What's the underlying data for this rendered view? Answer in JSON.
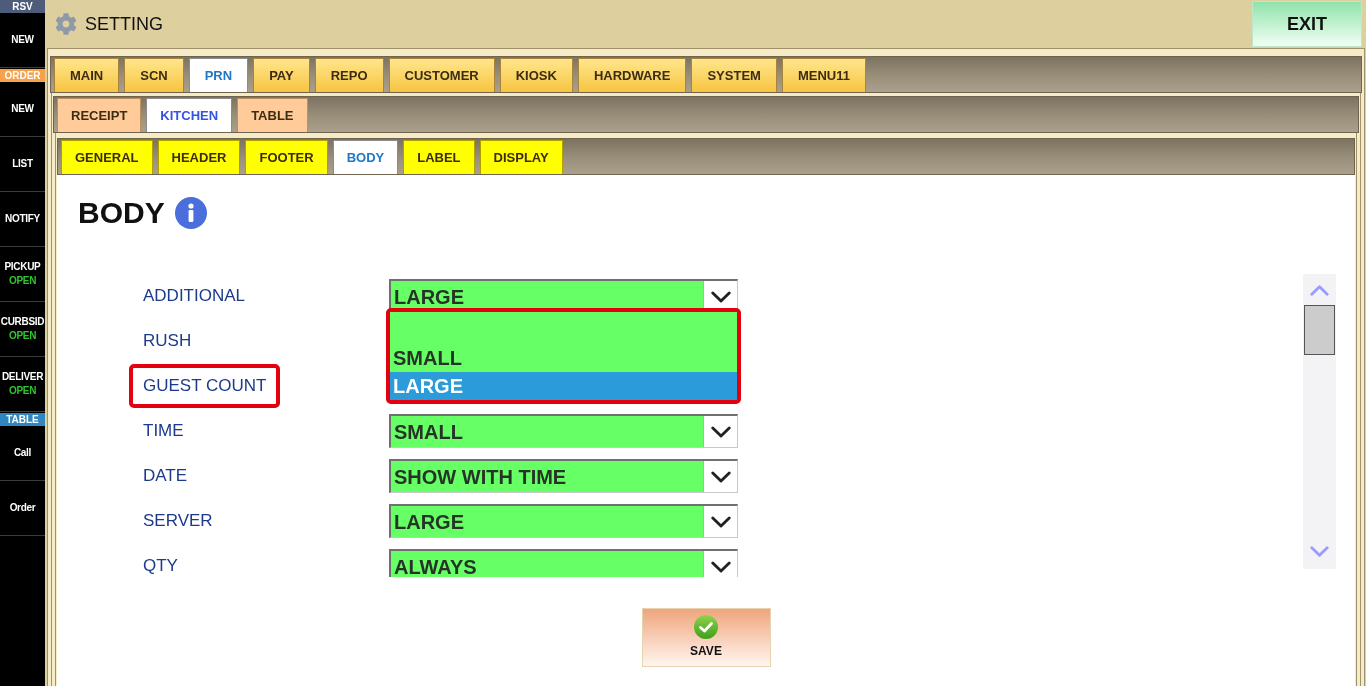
{
  "sidebar": {
    "sections": [
      {
        "title": "RSV",
        "color": "#4e5c7c",
        "items": [
          {
            "label": "NEW"
          }
        ]
      },
      {
        "title": "ORDER",
        "color": "#f7a24a",
        "items": [
          {
            "label": "NEW"
          },
          {
            "label": "LIST"
          },
          {
            "label": "NOTIFY"
          },
          {
            "label": "PICKUP",
            "status": "OPEN"
          },
          {
            "label": "CURBSID",
            "status": "OPEN"
          },
          {
            "label": "DELIVER",
            "status": "OPEN"
          }
        ]
      },
      {
        "title": "TABLE",
        "color": "#2f86c0",
        "items": [
          {
            "label": "Call"
          },
          {
            "label": "Order"
          }
        ]
      }
    ]
  },
  "header": {
    "title": "SETTING",
    "exit_button": "EXIT"
  },
  "main_tabs": [
    {
      "label": "MAIN",
      "selected": false
    },
    {
      "label": "SCN",
      "selected": false
    },
    {
      "label": "PRN",
      "selected": true
    },
    {
      "label": "PAY",
      "selected": false
    },
    {
      "label": "REPO",
      "selected": false
    },
    {
      "label": "CUSTOMER",
      "selected": false
    },
    {
      "label": "KIOSK",
      "selected": false
    },
    {
      "label": "HARDWARE",
      "selected": false
    },
    {
      "label": "SYSTEM",
      "selected": false
    },
    {
      "label": "MENU11",
      "selected": false
    }
  ],
  "sub_tabs": [
    {
      "label": "RECEIPT",
      "selected": false
    },
    {
      "label": "KITCHEN",
      "selected": true
    },
    {
      "label": "TABLE",
      "selected": false
    }
  ],
  "section_tabs": [
    {
      "label": "GENERAL",
      "selected": false
    },
    {
      "label": "HEADER",
      "selected": false
    },
    {
      "label": "FOOTER",
      "selected": false
    },
    {
      "label": "BODY",
      "selected": true
    },
    {
      "label": "LABEL",
      "selected": false
    },
    {
      "label": "DISPLAY",
      "selected": false
    }
  ],
  "section": {
    "title": "BODY"
  },
  "settings": [
    {
      "label": "ADDITIONAL",
      "value": "LARGE",
      "highlighted": false,
      "expanded": true,
      "dropdown": {
        "highlighted": true,
        "options": [
          {
            "label": "SMALL",
            "selected": false
          },
          {
            "label": "LARGE",
            "selected": true
          }
        ]
      }
    },
    {
      "label": "RUSH",
      "highlighted": false,
      "expanded": false
    },
    {
      "label": "GUEST COUNT",
      "highlighted": true,
      "expanded": false
    },
    {
      "label": "TIME",
      "value": "SMALL",
      "highlighted": false,
      "expanded": false
    },
    {
      "label": "DATE",
      "value": "SHOW WITH TIME",
      "highlighted": false,
      "expanded": false
    },
    {
      "label": "SERVER",
      "value": "LARGE",
      "highlighted": false,
      "expanded": false
    },
    {
      "label": "QTY",
      "value": "ALWAYS",
      "highlighted": false,
      "expanded": false
    }
  ],
  "save_button": "SAVE"
}
